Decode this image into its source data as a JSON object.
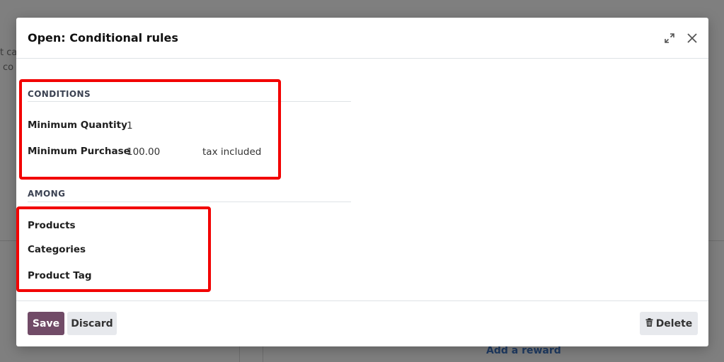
{
  "background": {
    "snippet_1": "t ca",
    "snippet_2": "co",
    "link": "Add a reward"
  },
  "modal": {
    "title": "Open: Conditional rules",
    "conditions": {
      "title": "CONDITIONS",
      "min_qty_label": "Minimum Quantity",
      "min_qty_value": "1",
      "min_purchase_label": "Minimum Purchase",
      "min_purchase_value": "100.00",
      "tax_mode": "tax included"
    },
    "among": {
      "title": "AMONG",
      "products_label": "Products",
      "categories_label": "Categories",
      "product_tag_label": "Product Tag"
    },
    "footer": {
      "save_label": "Save",
      "discard_label": "Discard",
      "delete_label": "Delete"
    }
  },
  "colors": {
    "primary": "#714b67",
    "highlight": "#f20000"
  }
}
